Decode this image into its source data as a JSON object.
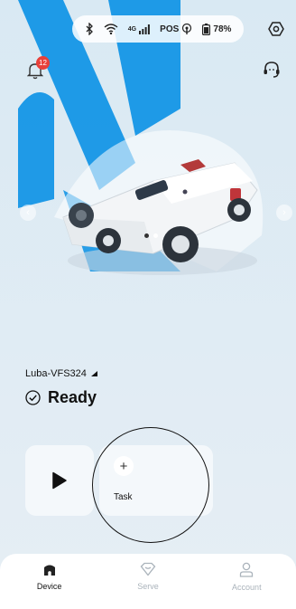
{
  "status_bar": {
    "battery_percent": "78%",
    "signal_label": "4G",
    "pos_label": "POS"
  },
  "notifications": {
    "count": "12"
  },
  "carousel": {
    "total": 2,
    "active_index": 0
  },
  "device": {
    "name": "Luba-VFS324",
    "state": "Ready"
  },
  "actions": {
    "task_label": "Task"
  },
  "tabs": [
    {
      "label": "Device",
      "active": true
    },
    {
      "label": "Serve",
      "active": false
    },
    {
      "label": "Account",
      "active": false
    }
  ],
  "colors": {
    "background": "#e3eef5",
    "badge": "#e8403a",
    "accent_blue": "#1496e6"
  }
}
